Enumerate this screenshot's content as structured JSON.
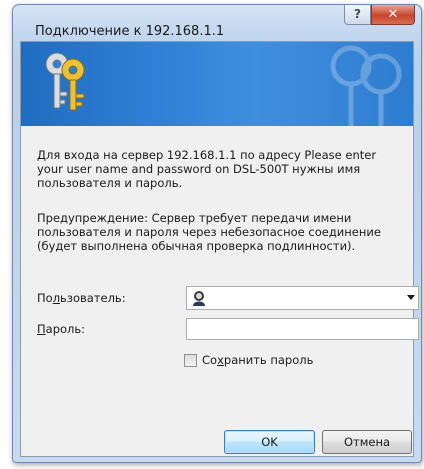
{
  "window": {
    "title": "Подключение к 192.168.1.1",
    "help_label": "?",
    "close_label": "✕"
  },
  "banner": {
    "icon": "keys-icon"
  },
  "message": {
    "line1": "Для входа на сервер 192.168.1.1 по адресу Please enter",
    "line2": "your user name and password on DSL-500T нужны имя",
    "line3": "пользователя и пароль."
  },
  "warning": {
    "line1": "Предупреждение: Сервер требует передачи имени",
    "line2": "пользователя и пароля через небезопасное соединение",
    "line3": "(будет выполнена обычная проверка подлинности)."
  },
  "form": {
    "username_label_pre": "По",
    "username_label_hotkey": "л",
    "username_label_post": "ьзователь:",
    "username_value": "",
    "username_icon": "user-icon",
    "password_label_hotkey": "П",
    "password_label_post": "ароль:",
    "password_value": "",
    "remember_label_pre": "Со",
    "remember_label_hotkey": "х",
    "remember_label_post": "ранить пароль",
    "remember_checked": false
  },
  "buttons": {
    "ok_label": "OK",
    "cancel_label": "Отмена"
  }
}
